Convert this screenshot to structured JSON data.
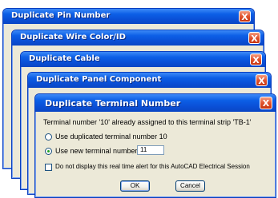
{
  "dialogs": [
    {
      "title": "Duplicate Pin Number"
    },
    {
      "title": "Duplicate Wire Color/ID"
    },
    {
      "title": "Duplicate Cable"
    },
    {
      "title": "Duplicate Panel Component"
    }
  ],
  "front_dialog": {
    "title": "Duplicate Terminal Number",
    "close_label": "X",
    "message": "Terminal number '10' already assigned to this terminal strip 'TB-1'",
    "option_use_duplicated": "Use duplicated terminal number 10",
    "option_use_new": "Use new terminal number",
    "new_number_value": "11",
    "selected_option": "use_new",
    "checkbox_label": "Do not display this real time alert for this AutoCAD Electrical Session",
    "checkbox_checked": false,
    "ok_label": "OK",
    "cancel_label": "Cancel"
  },
  "close_label": "X",
  "colors": {
    "title_bar": "#0a4fd6",
    "close_button": "#e0532f",
    "dialog_body": "#ece9d8"
  }
}
